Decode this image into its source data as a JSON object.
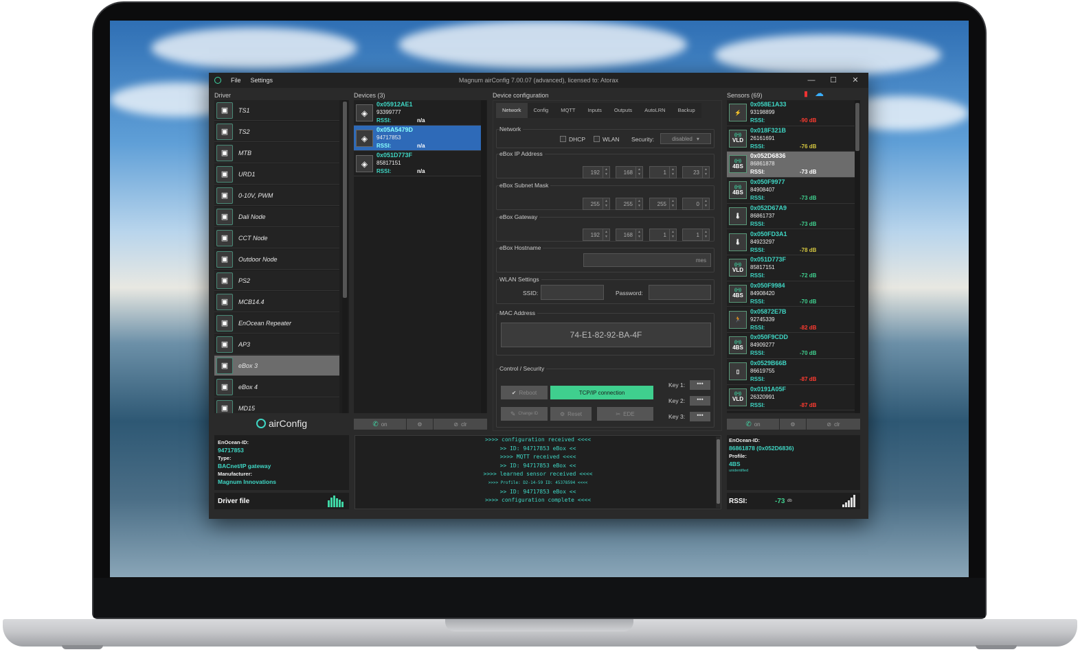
{
  "window": {
    "title": "Magnum airConfig 7.00.07 (advanced), licensed to: Atorax",
    "menu": [
      "File",
      "Settings"
    ],
    "min": "—",
    "max": "☐",
    "close": "✕"
  },
  "driver": {
    "label": "Driver",
    "items": [
      {
        "name": "TS1",
        "icon": "panel-icon"
      },
      {
        "name": "TS2",
        "icon": "panel-icon"
      },
      {
        "name": "MTB",
        "icon": "module-icon"
      },
      {
        "name": "URD1",
        "icon": "module-icon"
      },
      {
        "name": "0-10V, PWM",
        "icon": "module-icon"
      },
      {
        "name": "Dali Node",
        "icon": "node-icon"
      },
      {
        "name": "CCT Node",
        "icon": "node-icon"
      },
      {
        "name": "Outdoor Node",
        "icon": "node-icon"
      },
      {
        "name": "PS2",
        "icon": "sensor-icon"
      },
      {
        "name": "MCB14.4",
        "icon": "module-icon"
      },
      {
        "name": "EnOcean Repeater",
        "icon": "repeater-icon"
      },
      {
        "name": "AP3",
        "icon": "ebox-icon"
      },
      {
        "name": "eBox 3",
        "icon": "ebox-icon",
        "selected": true
      },
      {
        "name": "eBox 4",
        "icon": "ebox-icon"
      },
      {
        "name": "MD15",
        "icon": "module-icon"
      }
    ],
    "logo": "airConfig",
    "info": {
      "enocean_id_label": "EnOcean-ID:",
      "enocean_id": "94717853",
      "type_label": "Type:",
      "type": "BACnet/IP gateway",
      "manufacturer_label": "Manufacturer:",
      "manufacturer": "Magnum Innovations"
    },
    "driver_file": "Driver file"
  },
  "devices": {
    "label": "Devices (3)",
    "items": [
      {
        "id": "0x05912AE1",
        "num": "93399777",
        "rssi_label": "RSSI:",
        "rssi": "n/a"
      },
      {
        "id": "0x05A5479D",
        "num": "94717853",
        "rssi_label": "RSSI:",
        "rssi": "n/a",
        "selected": true
      },
      {
        "id": "0x051D773F",
        "num": "85817151",
        "rssi_label": "RSSI:",
        "rssi": "n/a"
      }
    ],
    "buttons": {
      "on": "on",
      "clr": "clr"
    }
  },
  "config": {
    "label": "Device configuration",
    "tabs": [
      "Network",
      "Config",
      "MQTT",
      "Inputs",
      "Outputs",
      "AutoLRN",
      "Backup"
    ],
    "network": {
      "label": "Network",
      "dhcp": "DHCP",
      "wlan": "WLAN",
      "security_label": "Security:",
      "security_value": "disabled"
    },
    "ip": {
      "label": "eBox IP Address",
      "values": [
        "192",
        "168",
        "1",
        "23"
      ]
    },
    "subnet": {
      "label": "eBox Subnet Mask",
      "values": [
        "255",
        "255",
        "255",
        "0"
      ]
    },
    "gateway": {
      "label": "eBox Gateway",
      "values": [
        "192",
        "168",
        "1",
        "1"
      ]
    },
    "hostname": {
      "label": "eBox Hostname",
      "value": "mes"
    },
    "wlan": {
      "label": "WLAN Settings",
      "ssid_label": "SSID:",
      "password_label": "Password:"
    },
    "mac": {
      "label": "MAC Address",
      "value": "74-E1-82-92-BA-4F"
    },
    "control": {
      "label": "Control / Security",
      "reboot": "Reboot",
      "tcp": "TCP/IP connection",
      "change_id": "Change ID",
      "reset": "Reset",
      "ede": "EDE",
      "key1": "Key 1:",
      "key2": "Key 2:",
      "key3": "Key 3:",
      "key_btn": "•••"
    },
    "accent": "#3fcf8e"
  },
  "log": [
    ">>>> configuration received <<<<",
    ">> ID: 94717853 eBox <<",
    ">>>> MQTT received <<<<",
    ">> ID: 94717853 eBox <<",
    ">>>> learned sensor received <<<<",
    ">>>> Profile: D2-14-59 ID: 45378594 <<<<",
    ">> ID: 94717853 eBox <<",
    ">>>> configuration complete <<<<"
  ],
  "sensors": {
    "label": "Sensors (69)",
    "items": [
      {
        "id": "0x058E1A33",
        "num": "93198899",
        "rssi_label": "RSSI:",
        "rssi": "-90 dB",
        "color": "#ff3b30",
        "icon": "switch-icon",
        "icon_text": ""
      },
      {
        "id": "0x018F321B",
        "num": "26161691",
        "rssi_label": "RSSI:",
        "rssi": "-76 dB",
        "color": "#d4c640",
        "icon": "vld-icon",
        "icon_text": "VLD"
      },
      {
        "id": "0x052D6836",
        "num": "86861878",
        "rssi_label": "RSSI:",
        "rssi": "-73 dB",
        "color": "#ffffff",
        "icon": "4bs-icon",
        "icon_text": "4BS",
        "selected": true
      },
      {
        "id": "0x050F9977",
        "num": "84908407",
        "rssi_label": "RSSI:",
        "rssi": "-73 dB",
        "color": "#3fcf8e",
        "icon": "4bs-icon",
        "icon_text": "4BS"
      },
      {
        "id": "0x052D67A9",
        "num": "86861737",
        "rssi_label": "RSSI:",
        "rssi": "-73 dB",
        "color": "#3fcf8e",
        "icon": "thermo-icon",
        "icon_text": ""
      },
      {
        "id": "0x050FD3A1",
        "num": "84923297",
        "rssi_label": "RSSI:",
        "rssi": "-78 dB",
        "color": "#d4c640",
        "icon": "thermo-icon",
        "icon_text": ""
      },
      {
        "id": "0x051D773F",
        "num": "85817151",
        "rssi_label": "RSSI:",
        "rssi": "-72 dB",
        "color": "#3fcf8e",
        "icon": "vld-icon",
        "icon_text": "VLD"
      },
      {
        "id": "0x050F9984",
        "num": "84908420",
        "rssi_label": "RSSI:",
        "rssi": "-70 dB",
        "color": "#3fcf8e",
        "icon": "4bs-icon",
        "icon_text": "4BS"
      },
      {
        "id": "0x05872E7B",
        "num": "92745339",
        "rssi_label": "RSSI:",
        "rssi": "-82 dB",
        "color": "#ff3b30",
        "icon": "motion-icon",
        "icon_text": ""
      },
      {
        "id": "0x050F9CDD",
        "num": "84909277",
        "rssi_label": "RSSI:",
        "rssi": "-70 dB",
        "color": "#3fcf8e",
        "icon": "4bs-icon",
        "icon_text": "4BS"
      },
      {
        "id": "0x0529B66B",
        "num": "86619755",
        "rssi_label": "RSSI:",
        "rssi": "-87 dB",
        "color": "#ff3b30",
        "icon": "contact-icon",
        "icon_text": ""
      },
      {
        "id": "0x0191A05F",
        "num": "26320991",
        "rssi_label": "RSSI:",
        "rssi": "-87 dB",
        "color": "#ff3b30",
        "icon": "vld-icon",
        "icon_text": "VLD"
      }
    ],
    "buttons": {
      "on": "on",
      "clr": "clr"
    },
    "info": {
      "enocean_id_label": "EnOcean-ID:",
      "enocean_id": "86861878 (0x052D6836)",
      "profile_label": "Profile:",
      "profile": "4BS",
      "profile_sub": "unidentified",
      "rssi_label": "RSSI:",
      "rssi": "-73",
      "rssi_unit": "db"
    }
  }
}
